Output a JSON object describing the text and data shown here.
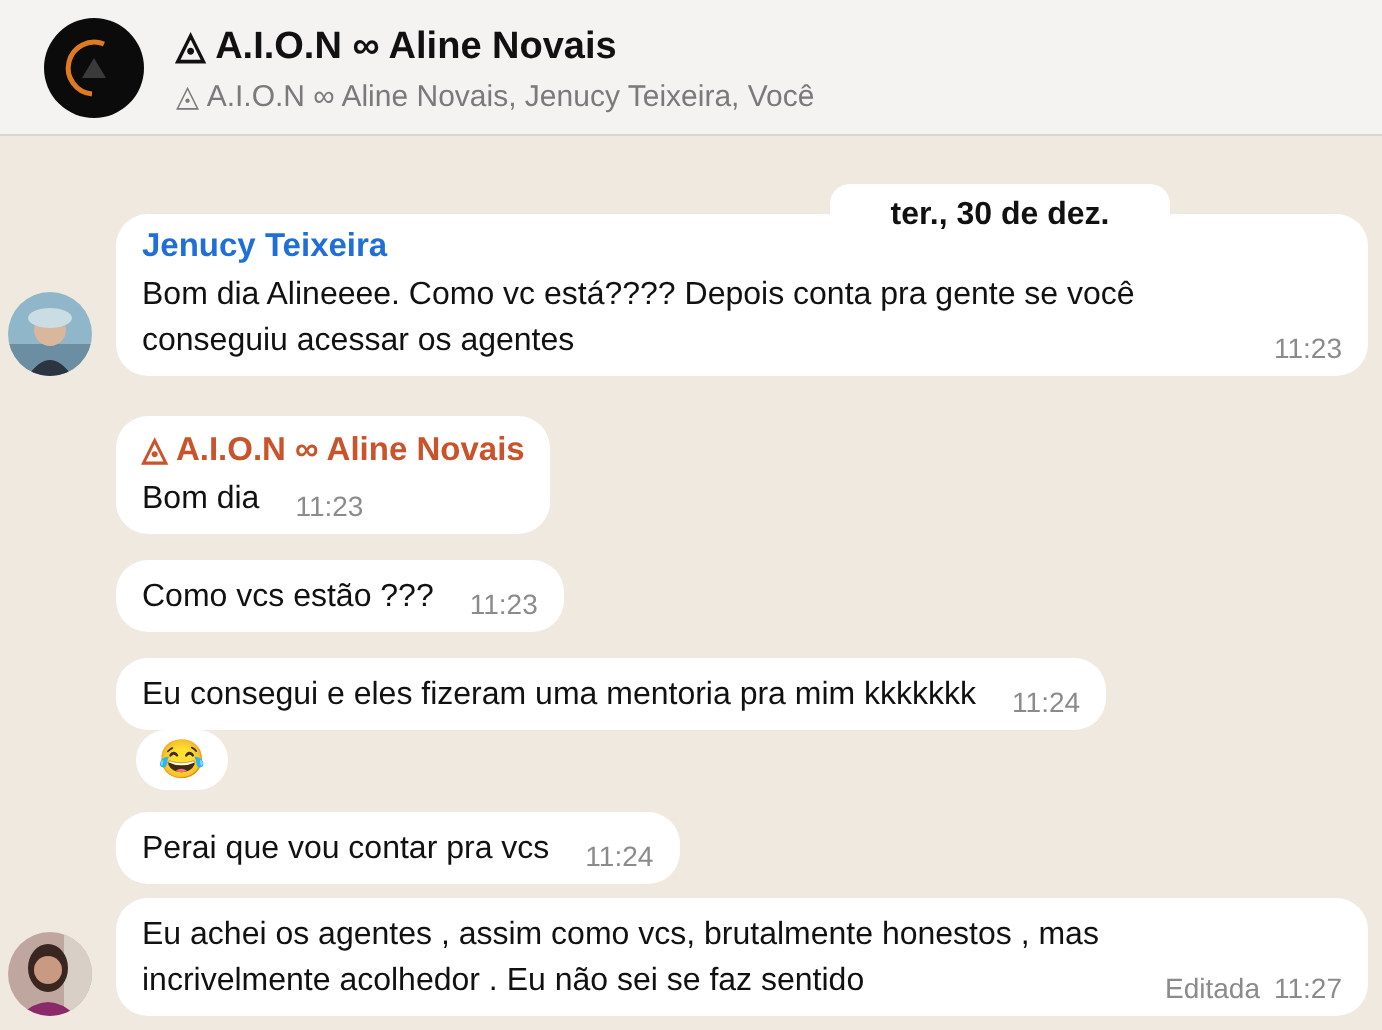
{
  "header": {
    "title": "◬ A.I.O.N ∞ Aline Novais",
    "members": "◬ A.I.O.N ∞ Aline Novais, Jenucy Teixeira, Você"
  },
  "date_label": "ter., 30 de dez.",
  "messages": [
    {
      "sender": "Jenucy Teixeira",
      "color": "#1f6fd6",
      "text": "Bom dia Alineeee. Como vc está???? Depois conta pra gente se você conseguiu acessar os agentes",
      "time": "11:23",
      "avatar": true
    },
    {
      "sender": "◬ A.I.O.N ∞ Aline Novais",
      "color": "#c9532a",
      "text": "Bom dia",
      "time": "11:23",
      "avatar": false
    },
    {
      "text": "Como vcs estão ???",
      "time": "11:23",
      "avatar": false
    },
    {
      "text": "Eu consegui e eles fizeram uma mentoria pra mim kkkkkkk",
      "time": "11:24",
      "avatar": false,
      "reaction": "😂"
    },
    {
      "text": "Perai que vou contar pra vcs",
      "time": "11:24",
      "avatar": false
    },
    {
      "text": "Eu achei os agentes , assim como vcs, brutalmente honestos , mas incrivelmente acolhedor . Eu não sei se faz sentido",
      "edited_label": "Editada",
      "time": "11:27",
      "avatar": true
    }
  ]
}
